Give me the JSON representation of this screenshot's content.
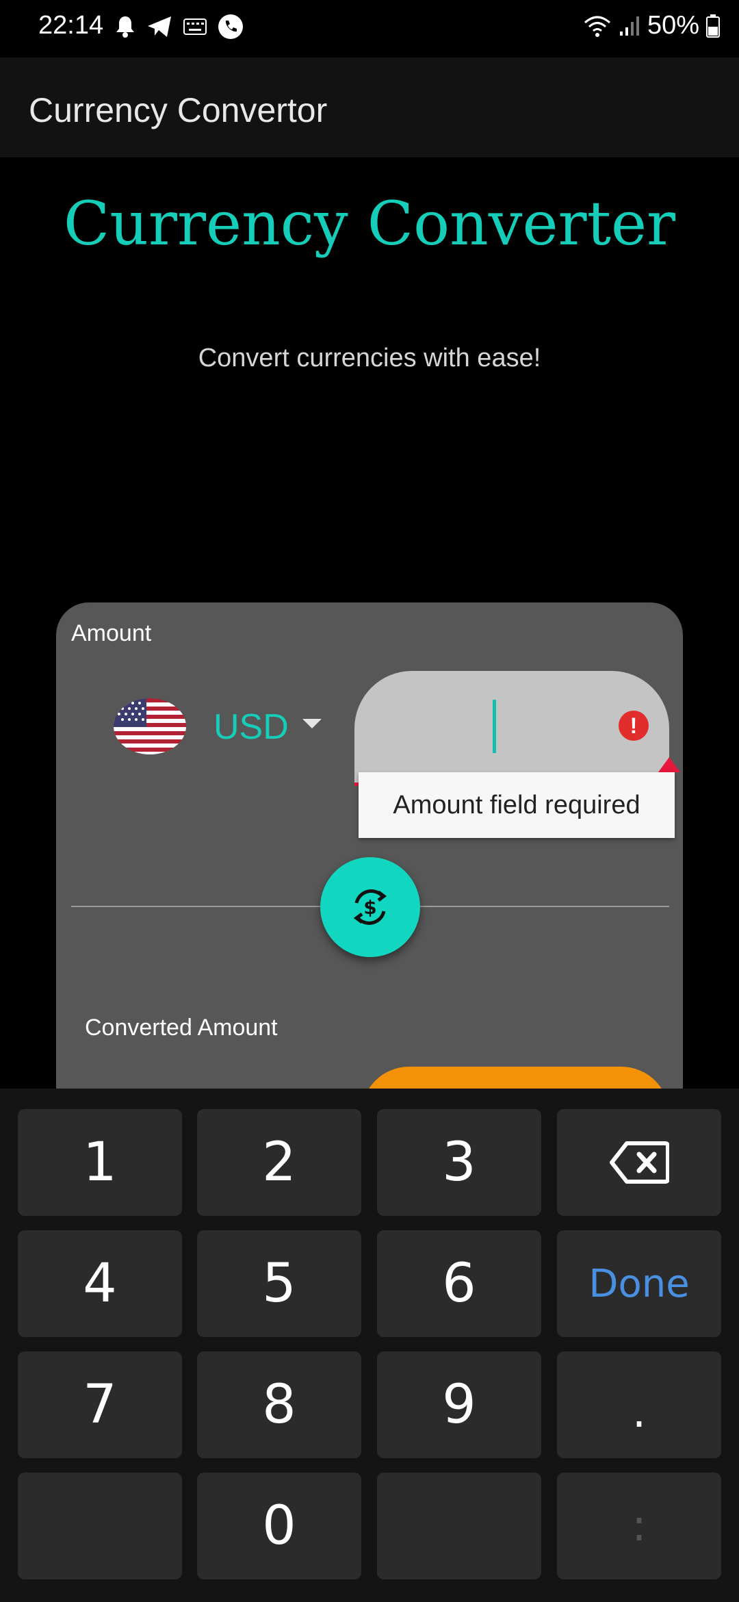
{
  "status_bar": {
    "time": "22:14",
    "battery": "50%",
    "left_icons": [
      "notification-bell-icon",
      "telegram-icon",
      "keyboard-icon",
      "phone-call-icon"
    ],
    "right_icons": [
      "wifi-icon",
      "signal-icon",
      "battery-icon"
    ]
  },
  "app_bar": {
    "title": "Currency Convertor"
  },
  "hero": {
    "title": "Currency Converter",
    "subtitle": "Convert currencies with ease!"
  },
  "card": {
    "amount_label": "Amount",
    "currency_code": "USD",
    "amount_input": {
      "value": "",
      "placeholder": ""
    },
    "error_message": "Amount field required",
    "converted_label": "Converted Amount"
  },
  "keyboard": {
    "keys": [
      "1",
      "2",
      "3",
      "4",
      "5",
      "6",
      "Done",
      "7",
      "8",
      "9",
      ".",
      "0",
      ":"
    ]
  },
  "colors": {
    "accent": "#15cdb8",
    "error": "#e8173c",
    "output": "#f39107",
    "done": "#4a90e2"
  }
}
